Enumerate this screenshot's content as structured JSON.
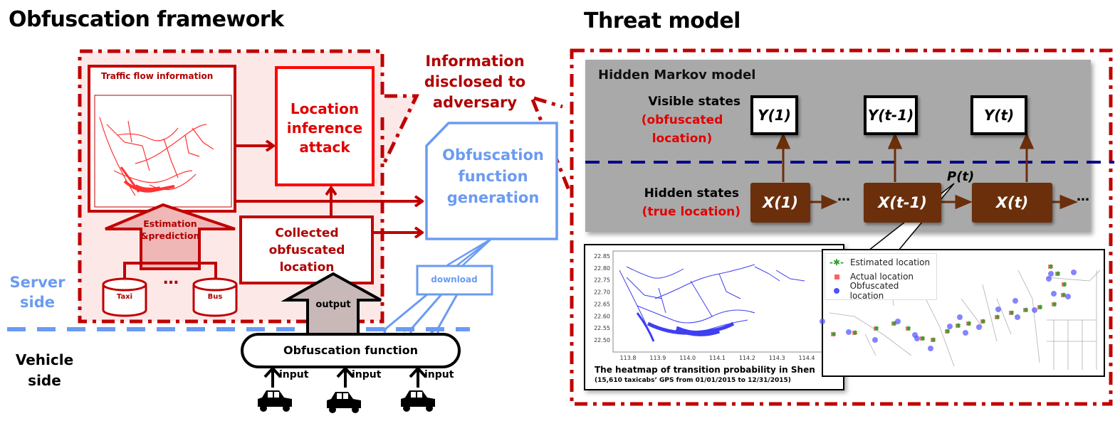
{
  "left_panel": {
    "title": "Obfuscation framework",
    "traffic_flow_label": "Traffic flow information",
    "location_inference_label": "Location inference attack",
    "estimation_label": "Estimation &prediction",
    "collected_label": "Collected obfuscated location",
    "databases": [
      {
        "label": "Taxi"
      },
      {
        "label": "Bus"
      }
    ],
    "db_ellipsis": "…",
    "info_disclosed_label": "Information disclosed to adversary",
    "obf_generation_label": "Obfuscation function generation",
    "download_label": "download",
    "output_label": "output",
    "server_side_label": "Server side",
    "vehicle_side_label": "Vehicle side",
    "obf_function_label": "Obfuscation function",
    "inputs": [
      {
        "label": "input",
        "icon": "car-icon"
      },
      {
        "label": "input",
        "icon": "car-icon"
      },
      {
        "label": "input",
        "icon": "car-icon"
      }
    ],
    "colors": {
      "server_red": "#c00000",
      "bright_red": "#ff0000",
      "server_bg": "#fde8e8",
      "vehicle_blue": "#6b9bf2",
      "output_gray": "#c8b8b8"
    }
  },
  "right_panel": {
    "title": "Threat model",
    "hmm_title": "Hidden Markov model",
    "visible_states_label": "Visible states",
    "visible_states_sub": "(obfuscated location)",
    "hidden_states_label": "Hidden states",
    "hidden_states_sub": "(true location)",
    "visible_nodes": [
      {
        "label": "Y(1)"
      },
      {
        "label": "Y(t-1)"
      },
      {
        "label": "Y(t)"
      }
    ],
    "hidden_nodes": [
      {
        "label": "X(1)"
      },
      {
        "label": "X(t-1)"
      },
      {
        "label": "X(t)"
      }
    ],
    "ellipsis": "…",
    "transition_label": "P(t)",
    "colors": {
      "hidden_node": "#6b2f0c",
      "divider_blue": "#00008b",
      "gray_bg": "#a9a9a9",
      "state_red": "#e00000"
    },
    "heatmap": {
      "y_ticks": [
        "22.85",
        "22.80",
        "22.75",
        "22.70",
        "22.65",
        "22.60",
        "22.55",
        "22.50"
      ],
      "x_ticks": [
        "113.8",
        "113.9",
        "114.0",
        "114.1",
        "114.2",
        "114.3",
        "114.4"
      ],
      "caption": "The heatmap of transition probability in Shen",
      "subcaption": "(15,610 taxicabs’ GPS from 01/01/2015 to 12/31/2015)"
    },
    "trajectory_legend": [
      {
        "label": "Estimated location",
        "color": "#2ca02c",
        "marker": "x-dashed"
      },
      {
        "label": "Actual location",
        "color": "#ff6060",
        "marker": "square"
      },
      {
        "label": "Obfuscated location",
        "color": "#5050ff",
        "marker": "circle"
      }
    ]
  }
}
